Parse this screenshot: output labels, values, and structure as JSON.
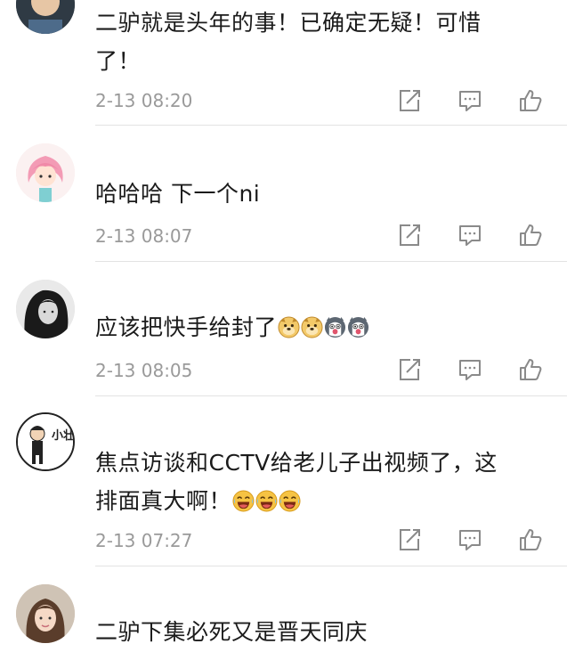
{
  "comments": [
    {
      "text_line1": "二驴就是头年的事！已确定无疑！可惜",
      "text_line2": "了！",
      "time": "2-13 08:20",
      "avatar": "boy-avatar"
    },
    {
      "text": "哈哈哈 下一个ni",
      "time": "2-13 08:07",
      "avatar": "pink-hair-girl-avatar"
    },
    {
      "text": "应该把快手给封了",
      "emojis": [
        "doge-emoji",
        "doge-emoji",
        "husky-emoji",
        "husky-emoji"
      ],
      "time": "2-13 08:05",
      "avatar": "woman-bw-avatar"
    },
    {
      "text_line1": "焦点访谈和CCTV给老儿子出视频了，这",
      "text_line2": "排面真大啊！",
      "emojis": [
        "laughing-cry-emoji",
        "laughing-cry-emoji",
        "laughing-cry-emoji"
      ],
      "time": "2-13 07:27",
      "avatar": "cartoon-avatar",
      "avatar_text": "小壮"
    },
    {
      "text": "二驴下集必死又是晋天同庆",
      "avatar": "girl-photo-avatar"
    }
  ],
  "icons": [
    "share-icon",
    "reply-icon",
    "like-icon"
  ],
  "colors": {
    "text": "#1b1b1b",
    "meta": "#9a9a9a",
    "icon": "#8a8a8a",
    "divider": "#e3e3e3"
  }
}
